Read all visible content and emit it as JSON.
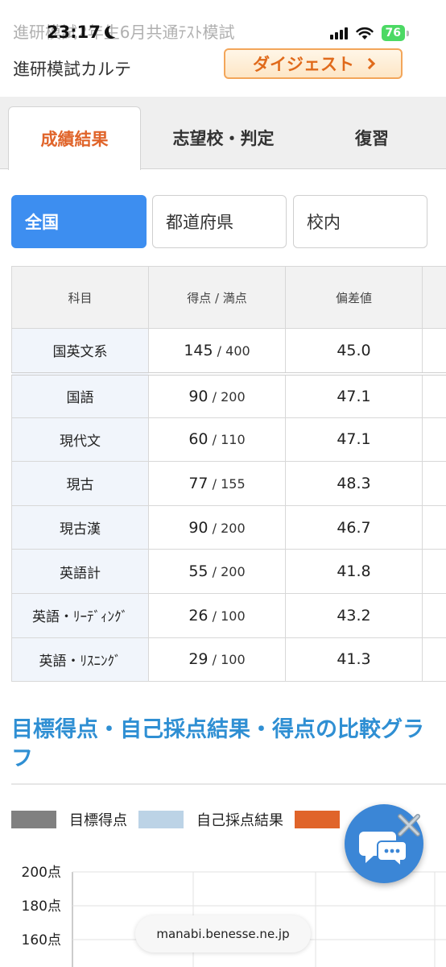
{
  "status_bar": {
    "page_title": "進研模試2年生6月共通ﾃｽﾄ模試",
    "time": "23:17",
    "battery": "76"
  },
  "header": {
    "title": "進研模試カルテ",
    "digest_label": "ダイジェスト"
  },
  "tabs": [
    {
      "label": "成績結果",
      "active": true
    },
    {
      "label": "志望校・判定",
      "active": false
    },
    {
      "label": "復習",
      "active": false
    }
  ],
  "regions": [
    {
      "label": "全国",
      "active": true
    },
    {
      "label": "都道府県",
      "active": false
    },
    {
      "label": "校内",
      "active": false
    }
  ],
  "table": {
    "headers": [
      "科目",
      "得点 / 満点",
      "偏差値"
    ],
    "rows": [
      {
        "subject": "国英文系",
        "score": "145",
        "max": "400",
        "deviation": "45.0"
      },
      {
        "subject": "国語",
        "score": "90",
        "max": "200",
        "deviation": "47.1"
      },
      {
        "subject": "現代文",
        "score": "60",
        "max": "110",
        "deviation": "47.1"
      },
      {
        "subject": "現古",
        "score": "77",
        "max": "155",
        "deviation": "48.3"
      },
      {
        "subject": "現古漢",
        "score": "90",
        "max": "200",
        "deviation": "46.7"
      },
      {
        "subject": "英語計",
        "score": "55",
        "max": "200",
        "deviation": "41.8"
      },
      {
        "subject": "英語・ﾘｰﾃﾞｨﾝｸﾞ",
        "score": "26",
        "max": "100",
        "deviation": "43.2"
      },
      {
        "subject": "英語・ﾘｽﾆﾝｸﾞ",
        "score": "29",
        "max": "100",
        "deviation": "41.3"
      }
    ]
  },
  "section": {
    "heading": "目標得点・自己採点結果・得点の比較グラフ"
  },
  "legend": [
    {
      "label": "目標得点",
      "color": "#808080"
    },
    {
      "label": "自己採点結果",
      "color": "#bcd3e6"
    },
    {
      "label": "",
      "color": "#e0642a"
    }
  ],
  "chart_data": {
    "type": "bar",
    "series": [
      {
        "name": "目標得点",
        "values": []
      },
      {
        "name": "自己採点結果",
        "values": []
      }
    ],
    "y_ticks": [
      "200点",
      "180点",
      "160点"
    ],
    "ylim": [
      160,
      200
    ],
    "grid": true
  },
  "url": "manabi.benesse.ne.jp",
  "colors": {
    "accent_blue": "#3d8ef0",
    "active_tab": "#e0642a",
    "heading_blue": "#2f8fd3"
  }
}
